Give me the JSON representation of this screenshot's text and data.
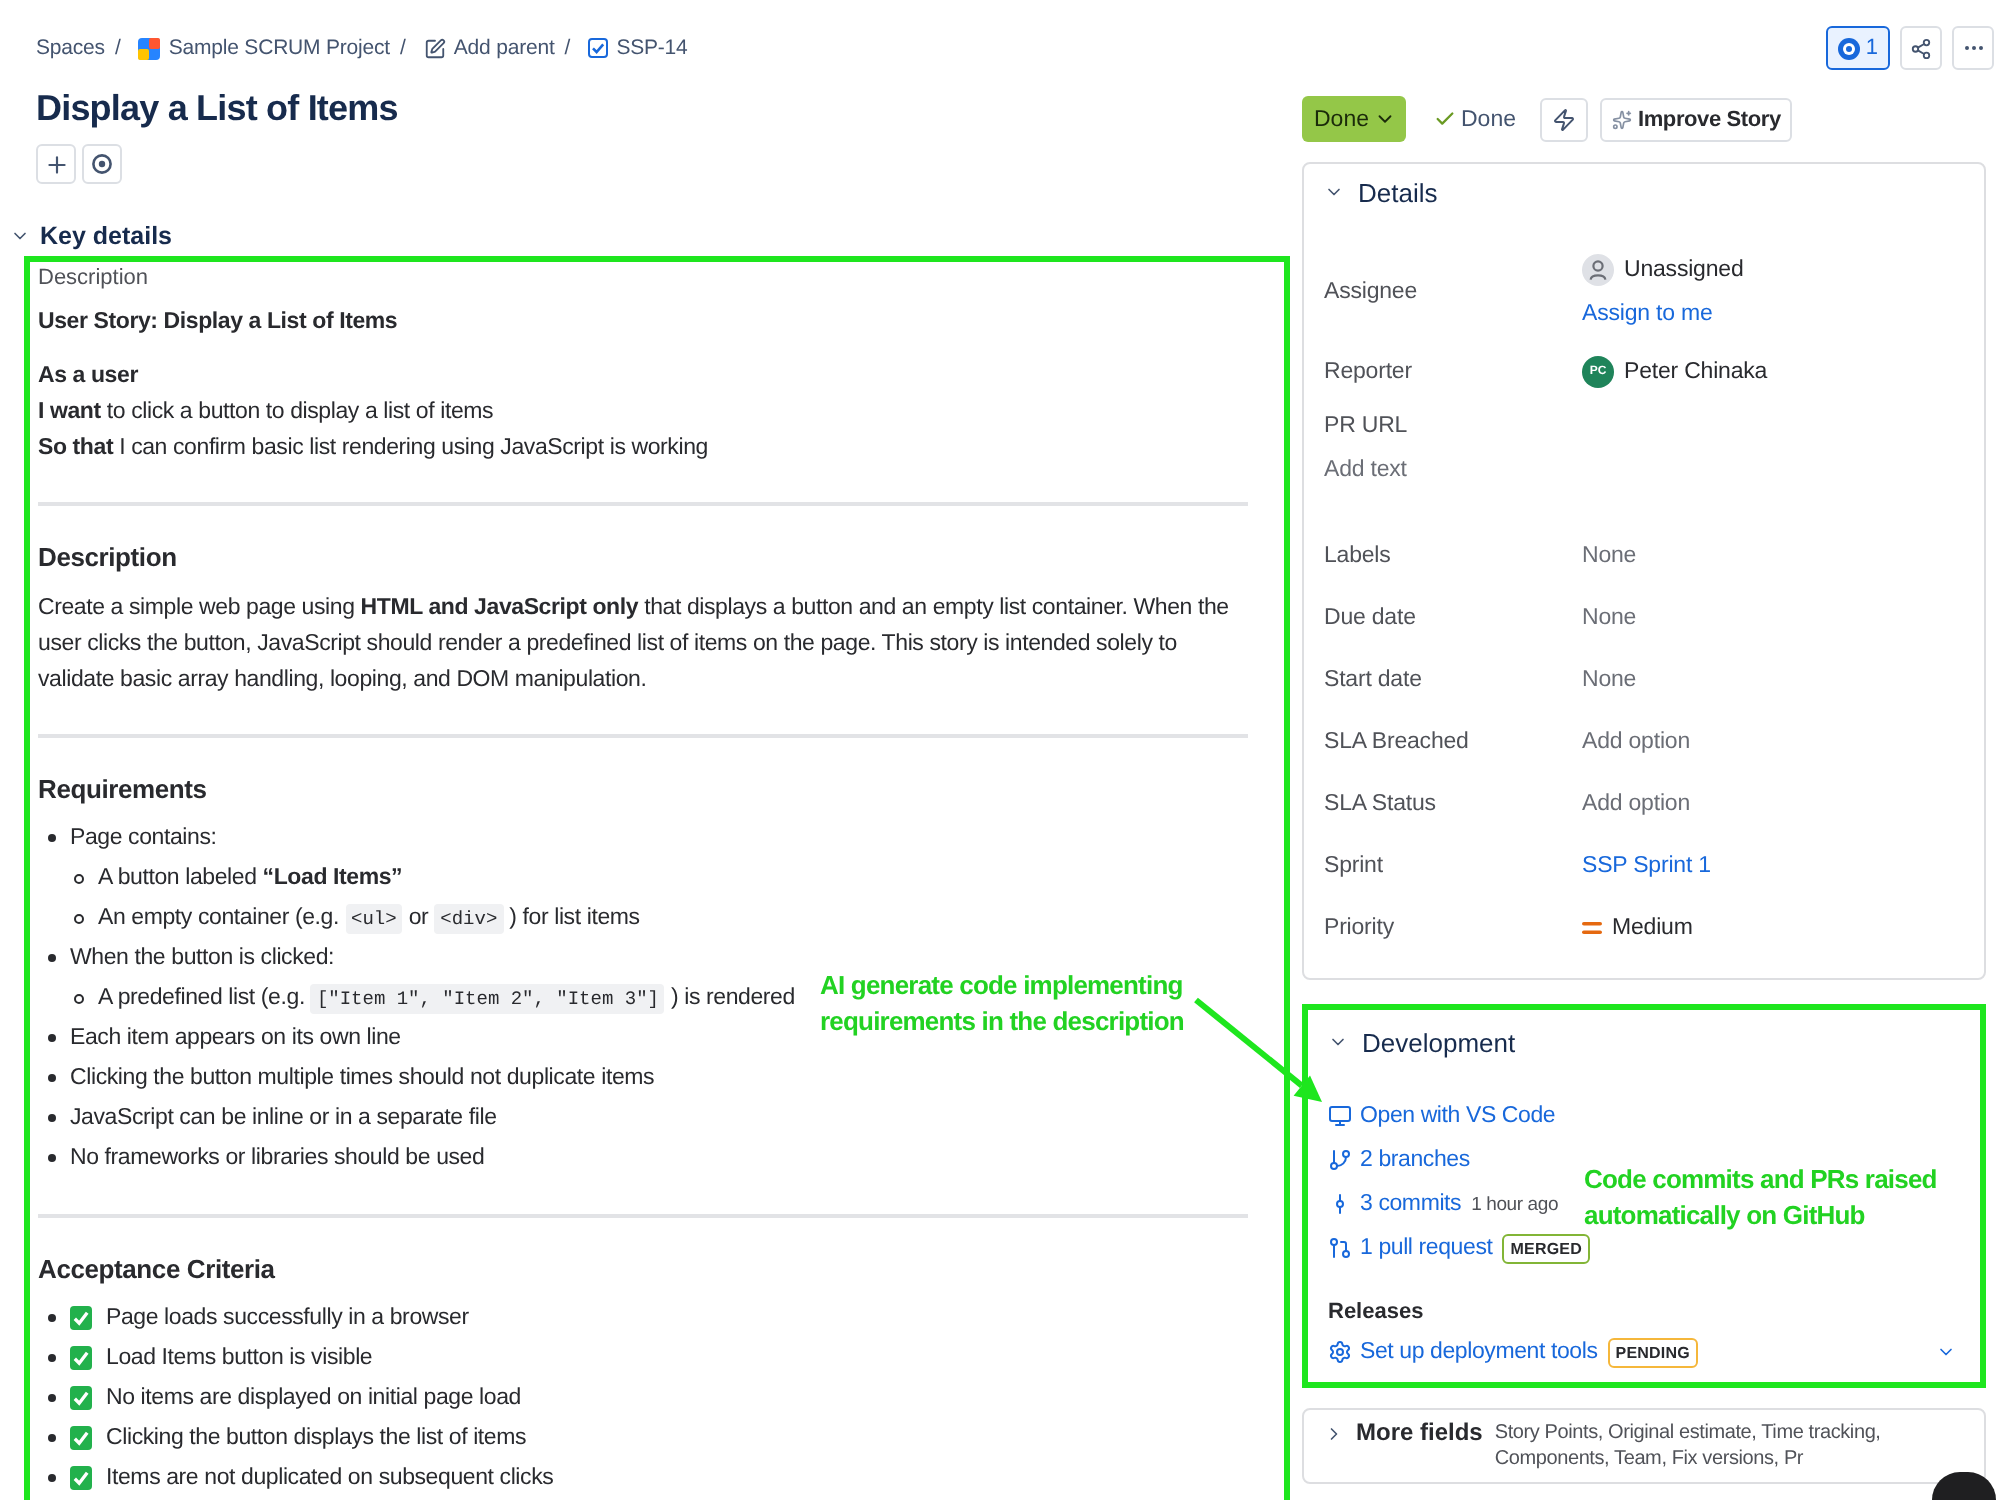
{
  "breadcrumbs": [
    {
      "kind": "text",
      "label": "Spaces",
      "separator": "/"
    },
    {
      "kind": "project",
      "label": "Sample SCRUM Project",
      "separator": "/"
    },
    {
      "kind": "edit",
      "label": "Add parent",
      "separator": "/"
    },
    {
      "kind": "issue",
      "label": "SSP-14"
    }
  ],
  "watch": {
    "count": "1",
    "watching": true
  },
  "title": "Display a List of Items",
  "status": {
    "label": "Done",
    "resolution": "Done"
  },
  "improve_button": "Improve Story",
  "key_details": {
    "heading": "Key details",
    "expanded": true,
    "label": "Description",
    "blocks": [
      {
        "kind": "title",
        "text": "User Story: Display a List of Items"
      },
      {
        "kind": "story",
        "role": "As a user",
        "want": "**I want** to click a button to display a list of items",
        "so_that": "**So that** I can confirm basic list rendering using JavaScript is working"
      },
      {
        "kind": "divider"
      },
      {
        "kind": "heading",
        "text": "Description"
      },
      {
        "kind": "paragraph",
        "text": "Create a simple web page using **HTML and JavaScript only** that displays a button and an empty list container. When the user clicks the button, JavaScript should render a predefined list of items on the page. This story is intended solely to validate basic array handling, looping, and DOM manipulation."
      },
      {
        "kind": "divider"
      },
      {
        "kind": "heading",
        "text": "Requirements"
      },
      {
        "kind": "bullets",
        "items": [
          {
            "text": "Page contains:",
            "children": [
              {
                "text": "A button labeled **“Load Items”**"
              },
              {
                "segments": [
                  {
                    "kind": "text",
                    "text": "An empty container (e.g."
                  },
                  {
                    "kind": "code",
                    "text": "<ul>"
                  },
                  {
                    "kind": "text",
                    "text": "or"
                  },
                  {
                    "kind": "code",
                    "text": "<div>"
                  },
                  {
                    "kind": "text",
                    "text": ") for list items"
                  }
                ]
              }
            ]
          },
          {
            "text": "When the button is clicked:",
            "children": [
              {
                "segments": [
                  {
                    "kind": "text",
                    "text": "A predefined list (e.g."
                  },
                  {
                    "kind": "code",
                    "text": "[\"Item 1\", \"Item 2\", \"Item 3\"]"
                  },
                  {
                    "kind": "text",
                    "text": ") is rendered"
                  }
                ]
              }
            ]
          },
          {
            "text": "Each item appears on its own line"
          },
          {
            "text": "Clicking the button multiple times should not duplicate items"
          },
          {
            "text": "JavaScript can be inline or in a separate file"
          },
          {
            "text": "No frameworks or libraries should be used"
          }
        ]
      },
      {
        "kind": "divider"
      },
      {
        "kind": "heading",
        "text": "Acceptance Criteria"
      },
      {
        "kind": "checklist",
        "items": [
          {
            "text": "Page loads successfully in a browser",
            "checked": true
          },
          {
            "text": "Load Items button is visible",
            "checked": true
          },
          {
            "text": "No items are displayed on initial page load",
            "checked": true
          },
          {
            "text": "Clicking the button displays the list of items",
            "checked": true
          },
          {
            "text": "Items are not duplicated on subsequent clicks",
            "checked": true
          }
        ]
      }
    ],
    "annotation": {
      "lines": [
        "AI generate code implementing",
        "requirements in the description"
      ]
    }
  },
  "details": {
    "heading": "Details",
    "expanded": true,
    "fields": [
      {
        "kind": "user",
        "label": "Assignee",
        "value": "Unassigned",
        "link": "Assign to me"
      },
      {
        "kind": "user",
        "label": "Reporter",
        "value": "Peter Chinaka",
        "initials": "PC"
      },
      {
        "kind": "stacked",
        "label": "PR URL",
        "placeholder": "Add text"
      },
      {
        "kind": "muted",
        "label": "Labels",
        "value": "None"
      },
      {
        "kind": "muted",
        "label": "Due date",
        "value": "None"
      },
      {
        "kind": "muted",
        "label": "Start date",
        "value": "None"
      },
      {
        "kind": "muted",
        "label": "SLA Breached",
        "value": "Add option"
      },
      {
        "kind": "muted",
        "label": "SLA Status",
        "value": "Add option"
      },
      {
        "kind": "link",
        "label": "Sprint",
        "value": "SSP Sprint 1"
      },
      {
        "kind": "priority",
        "label": "Priority",
        "value": "Medium"
      }
    ]
  },
  "development": {
    "heading": "Development",
    "expanded": true,
    "items": [
      {
        "kind": "vscode",
        "label": "Open with VS Code"
      },
      {
        "kind": "branches",
        "label": "2 branches"
      },
      {
        "kind": "commits",
        "label": "3 commits",
        "meta": "1 hour ago"
      },
      {
        "kind": "pull_requests",
        "label": "1 pull request",
        "badge": {
          "text": "MERGED",
          "kind": "success"
        }
      }
    ],
    "releases": {
      "heading": "Releases",
      "items": [
        {
          "label": "Set up deployment tools",
          "badge": {
            "text": "PENDING",
            "kind": "warning"
          },
          "expanded": false
        }
      ]
    },
    "annotation": {
      "lines": [
        "Code commits and PRs raised",
        "automatically on GitHub"
      ]
    }
  },
  "more_fields": {
    "heading": "More fields",
    "summary": "Story Points, Original estimate, Time tracking, Components, Team, Fix versions, Pr",
    "expanded": false
  }
}
